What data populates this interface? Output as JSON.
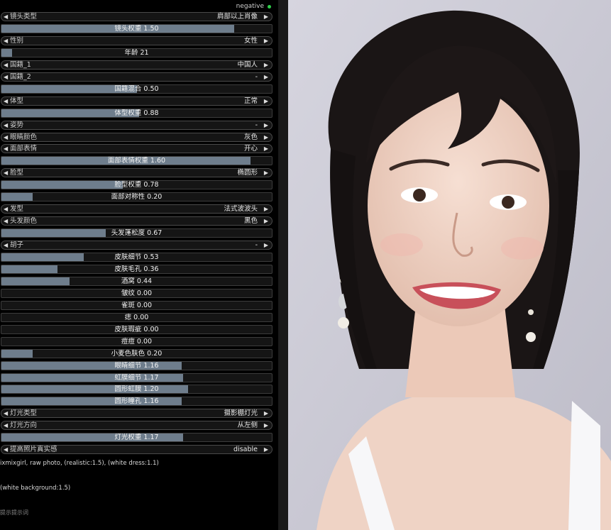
{
  "header": {
    "negative_label": "negative"
  },
  "controls": [
    {
      "kind": "combo",
      "label": "镜头类型",
      "value": "肩部以上肖像"
    },
    {
      "kind": "slider",
      "text": "镜头权重  1.50",
      "fill": 0.86
    },
    {
      "kind": "combo",
      "label": "性别",
      "value": "女性"
    },
    {
      "kind": "slider",
      "text": "年龄  21",
      "fill": 0.04
    },
    {
      "kind": "combo",
      "label": "国籍_1",
      "value": "中国人"
    },
    {
      "kind": "combo",
      "label": "国籍_2",
      "value": "-"
    },
    {
      "kind": "slider",
      "text": "国籍混合  0.50",
      "fill": 0.5
    },
    {
      "kind": "combo",
      "label": "体型",
      "value": "正常"
    },
    {
      "kind": "slider",
      "text": "体型权重  0.88",
      "fill": 0.51
    },
    {
      "kind": "combo",
      "label": "姿势",
      "value": "-"
    },
    {
      "kind": "combo",
      "label": "眼睛颜色",
      "value": "灰色"
    },
    {
      "kind": "combo",
      "label": "面部表情",
      "value": "开心"
    },
    {
      "kind": "slider",
      "text": "面部表情权重  1.60",
      "fill": 0.92
    },
    {
      "kind": "combo",
      "label": "脸型",
      "value": "椭圆形"
    },
    {
      "kind": "slider",
      "text": "脸型权重  0.78",
      "fill": 0.45
    },
    {
      "kind": "slider",
      "text": "面部对称性  0.20",
      "fill": 0.115
    },
    {
      "kind": "combo",
      "label": "发型",
      "value": "法式波波头"
    },
    {
      "kind": "combo",
      "label": "头发颜色",
      "value": "黑色"
    },
    {
      "kind": "slider",
      "text": "头发蓬松度  0.67",
      "fill": 0.385
    },
    {
      "kind": "combo",
      "label": "胡子",
      "value": "-"
    },
    {
      "kind": "slider",
      "text": "皮肤细节  0.53",
      "fill": 0.305
    },
    {
      "kind": "slider",
      "text": "皮肤毛孔  0.36",
      "fill": 0.207
    },
    {
      "kind": "slider",
      "text": "酒窝  0.44",
      "fill": 0.253
    },
    {
      "kind": "slider",
      "text": "皱纹  0.00",
      "fill": 0.0
    },
    {
      "kind": "slider",
      "text": "雀斑  0.00",
      "fill": 0.0
    },
    {
      "kind": "slider",
      "text": "痣  0.00",
      "fill": 0.0
    },
    {
      "kind": "slider",
      "text": "皮肤瑕疵  0.00",
      "fill": 0.0
    },
    {
      "kind": "slider",
      "text": "痘痘  0.00",
      "fill": 0.0
    },
    {
      "kind": "slider",
      "text": "小麦色肤色  0.20",
      "fill": 0.115
    },
    {
      "kind": "slider",
      "text": "眼睛细节  1.16",
      "fill": 0.667
    },
    {
      "kind": "slider",
      "text": "虹膜细节  1.17",
      "fill": 0.672
    },
    {
      "kind": "slider",
      "text": "圆形虹膜  1.20",
      "fill": 0.69
    },
    {
      "kind": "slider",
      "text": "圆形瞳孔  1.16",
      "fill": 0.667
    },
    {
      "kind": "combo",
      "label": "灯光类型",
      "value": "摄影棚灯光"
    },
    {
      "kind": "combo",
      "label": "灯光方向",
      "value": "从左侧"
    },
    {
      "kind": "slider",
      "text": "灯光权重  1.17",
      "fill": 0.672
    },
    {
      "kind": "combo",
      "label": "提高照片真实感",
      "value": "disable"
    }
  ],
  "prompts": {
    "positive": "ixmixgirl, raw photo, (realistic:1.5), (white dress:1.1)",
    "negative": "(white background:1.5)",
    "hint": "提示提示词"
  },
  "photo": {
    "alt": "portrait"
  },
  "colors": {
    "panel_bg": "#000000",
    "slider_fill": "#6e7d8c",
    "status_dot": "#2fd14b",
    "photo_bg": "#c9c8d4"
  }
}
